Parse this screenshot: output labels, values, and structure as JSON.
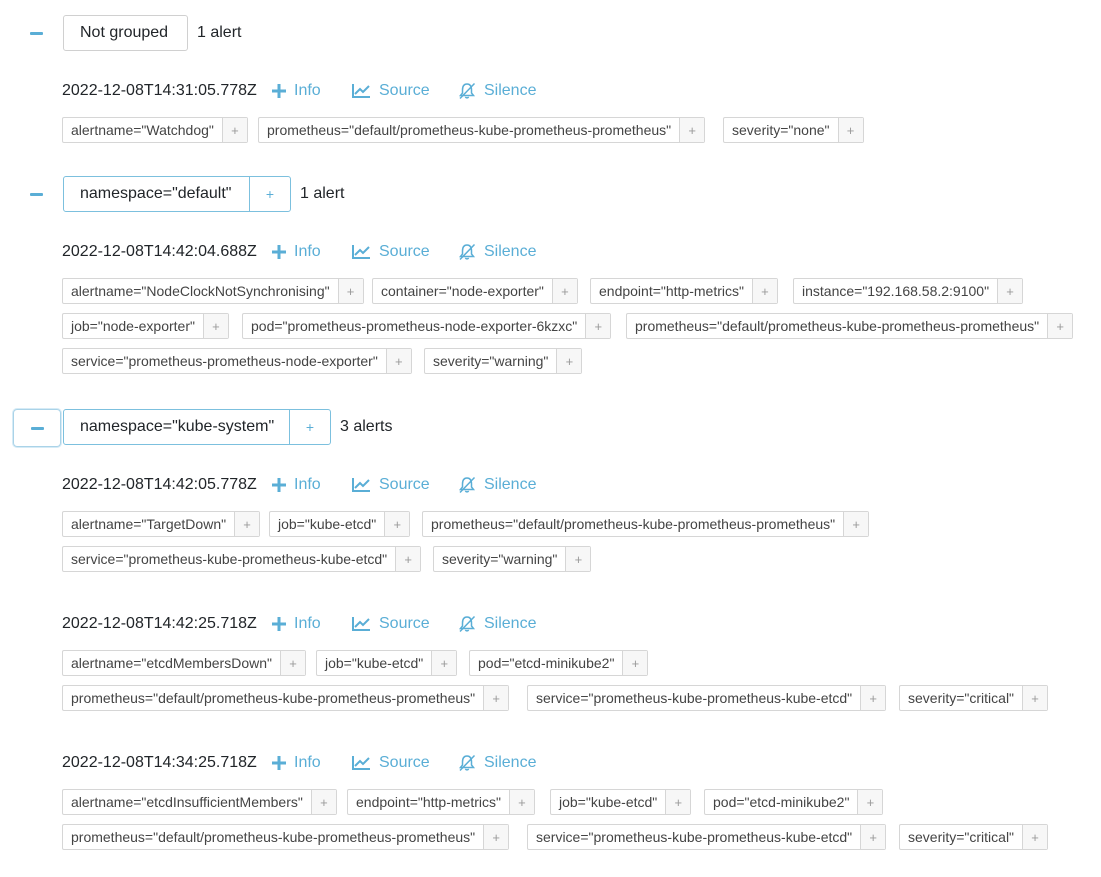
{
  "groups": [
    {
      "label": "Not grouped",
      "count": "1 alert",
      "alerts": [
        {
          "timestamp": "2022-12-08T14:31:05.778Z",
          "labels": [
            "alertname=\"Watchdog\"",
            "prometheus=\"default/prometheus-kube-prometheus-prometheus\"",
            "severity=\"none\""
          ]
        }
      ]
    },
    {
      "label": "namespace=\"default\"",
      "count": "1 alert",
      "alerts": [
        {
          "timestamp": "2022-12-08T14:42:04.688Z",
          "labels": [
            "alertname=\"NodeClockNotSynchronising\"",
            "container=\"node-exporter\"",
            "endpoint=\"http-metrics\"",
            "instance=\"192.168.58.2:9100\"",
            "job=\"node-exporter\"",
            "pod=\"prometheus-prometheus-node-exporter-6kzxc\"",
            "prometheus=\"default/prometheus-kube-prometheus-prometheus\"",
            "service=\"prometheus-prometheus-node-exporter\"",
            "severity=\"warning\""
          ]
        }
      ]
    },
    {
      "label": "namespace=\"kube-system\"",
      "count": "3 alerts",
      "alerts": [
        {
          "timestamp": "2022-12-08T14:42:05.778Z",
          "labels": [
            "alertname=\"TargetDown\"",
            "job=\"kube-etcd\"",
            "prometheus=\"default/prometheus-kube-prometheus-prometheus\"",
            "service=\"prometheus-kube-prometheus-kube-etcd\"",
            "severity=\"warning\""
          ]
        },
        {
          "timestamp": "2022-12-08T14:42:25.718Z",
          "labels": [
            "alertname=\"etcdMembersDown\"",
            "job=\"kube-etcd\"",
            "pod=\"etcd-minikube2\"",
            "prometheus=\"default/prometheus-kube-prometheus-prometheus\"",
            "service=\"prometheus-kube-prometheus-kube-etcd\"",
            "severity=\"critical\""
          ]
        },
        {
          "timestamp": "2022-12-08T14:34:25.718Z",
          "labels": [
            "alertname=\"etcdInsufficientMembers\"",
            "endpoint=\"http-metrics\"",
            "job=\"kube-etcd\"",
            "pod=\"etcd-minikube2\"",
            "prometheus=\"default/prometheus-kube-prometheus-prometheus\"",
            "service=\"prometheus-kube-prometheus-kube-etcd\"",
            "severity=\"critical\""
          ]
        }
      ]
    }
  ],
  "actions": {
    "info": "Info",
    "source": "Source",
    "silence": "Silence",
    "add_symbol": "+"
  },
  "icons": {
    "collapse": "minus-icon",
    "info": "plus-icon",
    "source": "chart-line-icon",
    "silence": "bell-slash-icon"
  },
  "colors": {
    "accent": "#5aaed6",
    "tag_border": "#d6d6d6"
  }
}
